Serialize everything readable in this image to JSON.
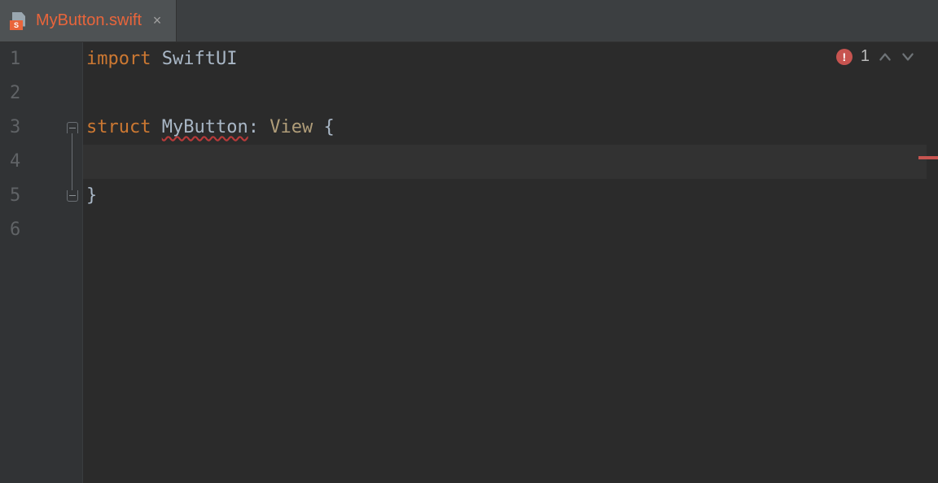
{
  "tab": {
    "title": "MyButton.swift",
    "icon_badge": "S",
    "icon_name": "swift-file-icon",
    "close_glyph": "×"
  },
  "editor": {
    "line_numbers": [
      "1",
      "2",
      "3",
      "4",
      "5",
      "6"
    ],
    "highlighted_line_index": 3,
    "code": {
      "line1": {
        "kw": "import",
        "sp": " ",
        "mod": "SwiftUI"
      },
      "line3": {
        "kw": "struct",
        "sp": " ",
        "name": "MyButton",
        "colon": ":",
        "sp2": " ",
        "conform": "View",
        "sp3": " ",
        "brace": "{"
      },
      "line5": {
        "brace": "}"
      }
    }
  },
  "diagnostics": {
    "error_count": "1",
    "error_badge": "!"
  },
  "fold": {
    "start_line_index": 2,
    "end_line_index": 4
  },
  "colors": {
    "tab_active_bg": "#4e5254",
    "tab_title": "#e9653b",
    "bg": "#2b2b2b",
    "gutter_bg": "#313335",
    "keyword": "#cc7832",
    "type_ref": "#b09d79",
    "error": "#c75450"
  }
}
